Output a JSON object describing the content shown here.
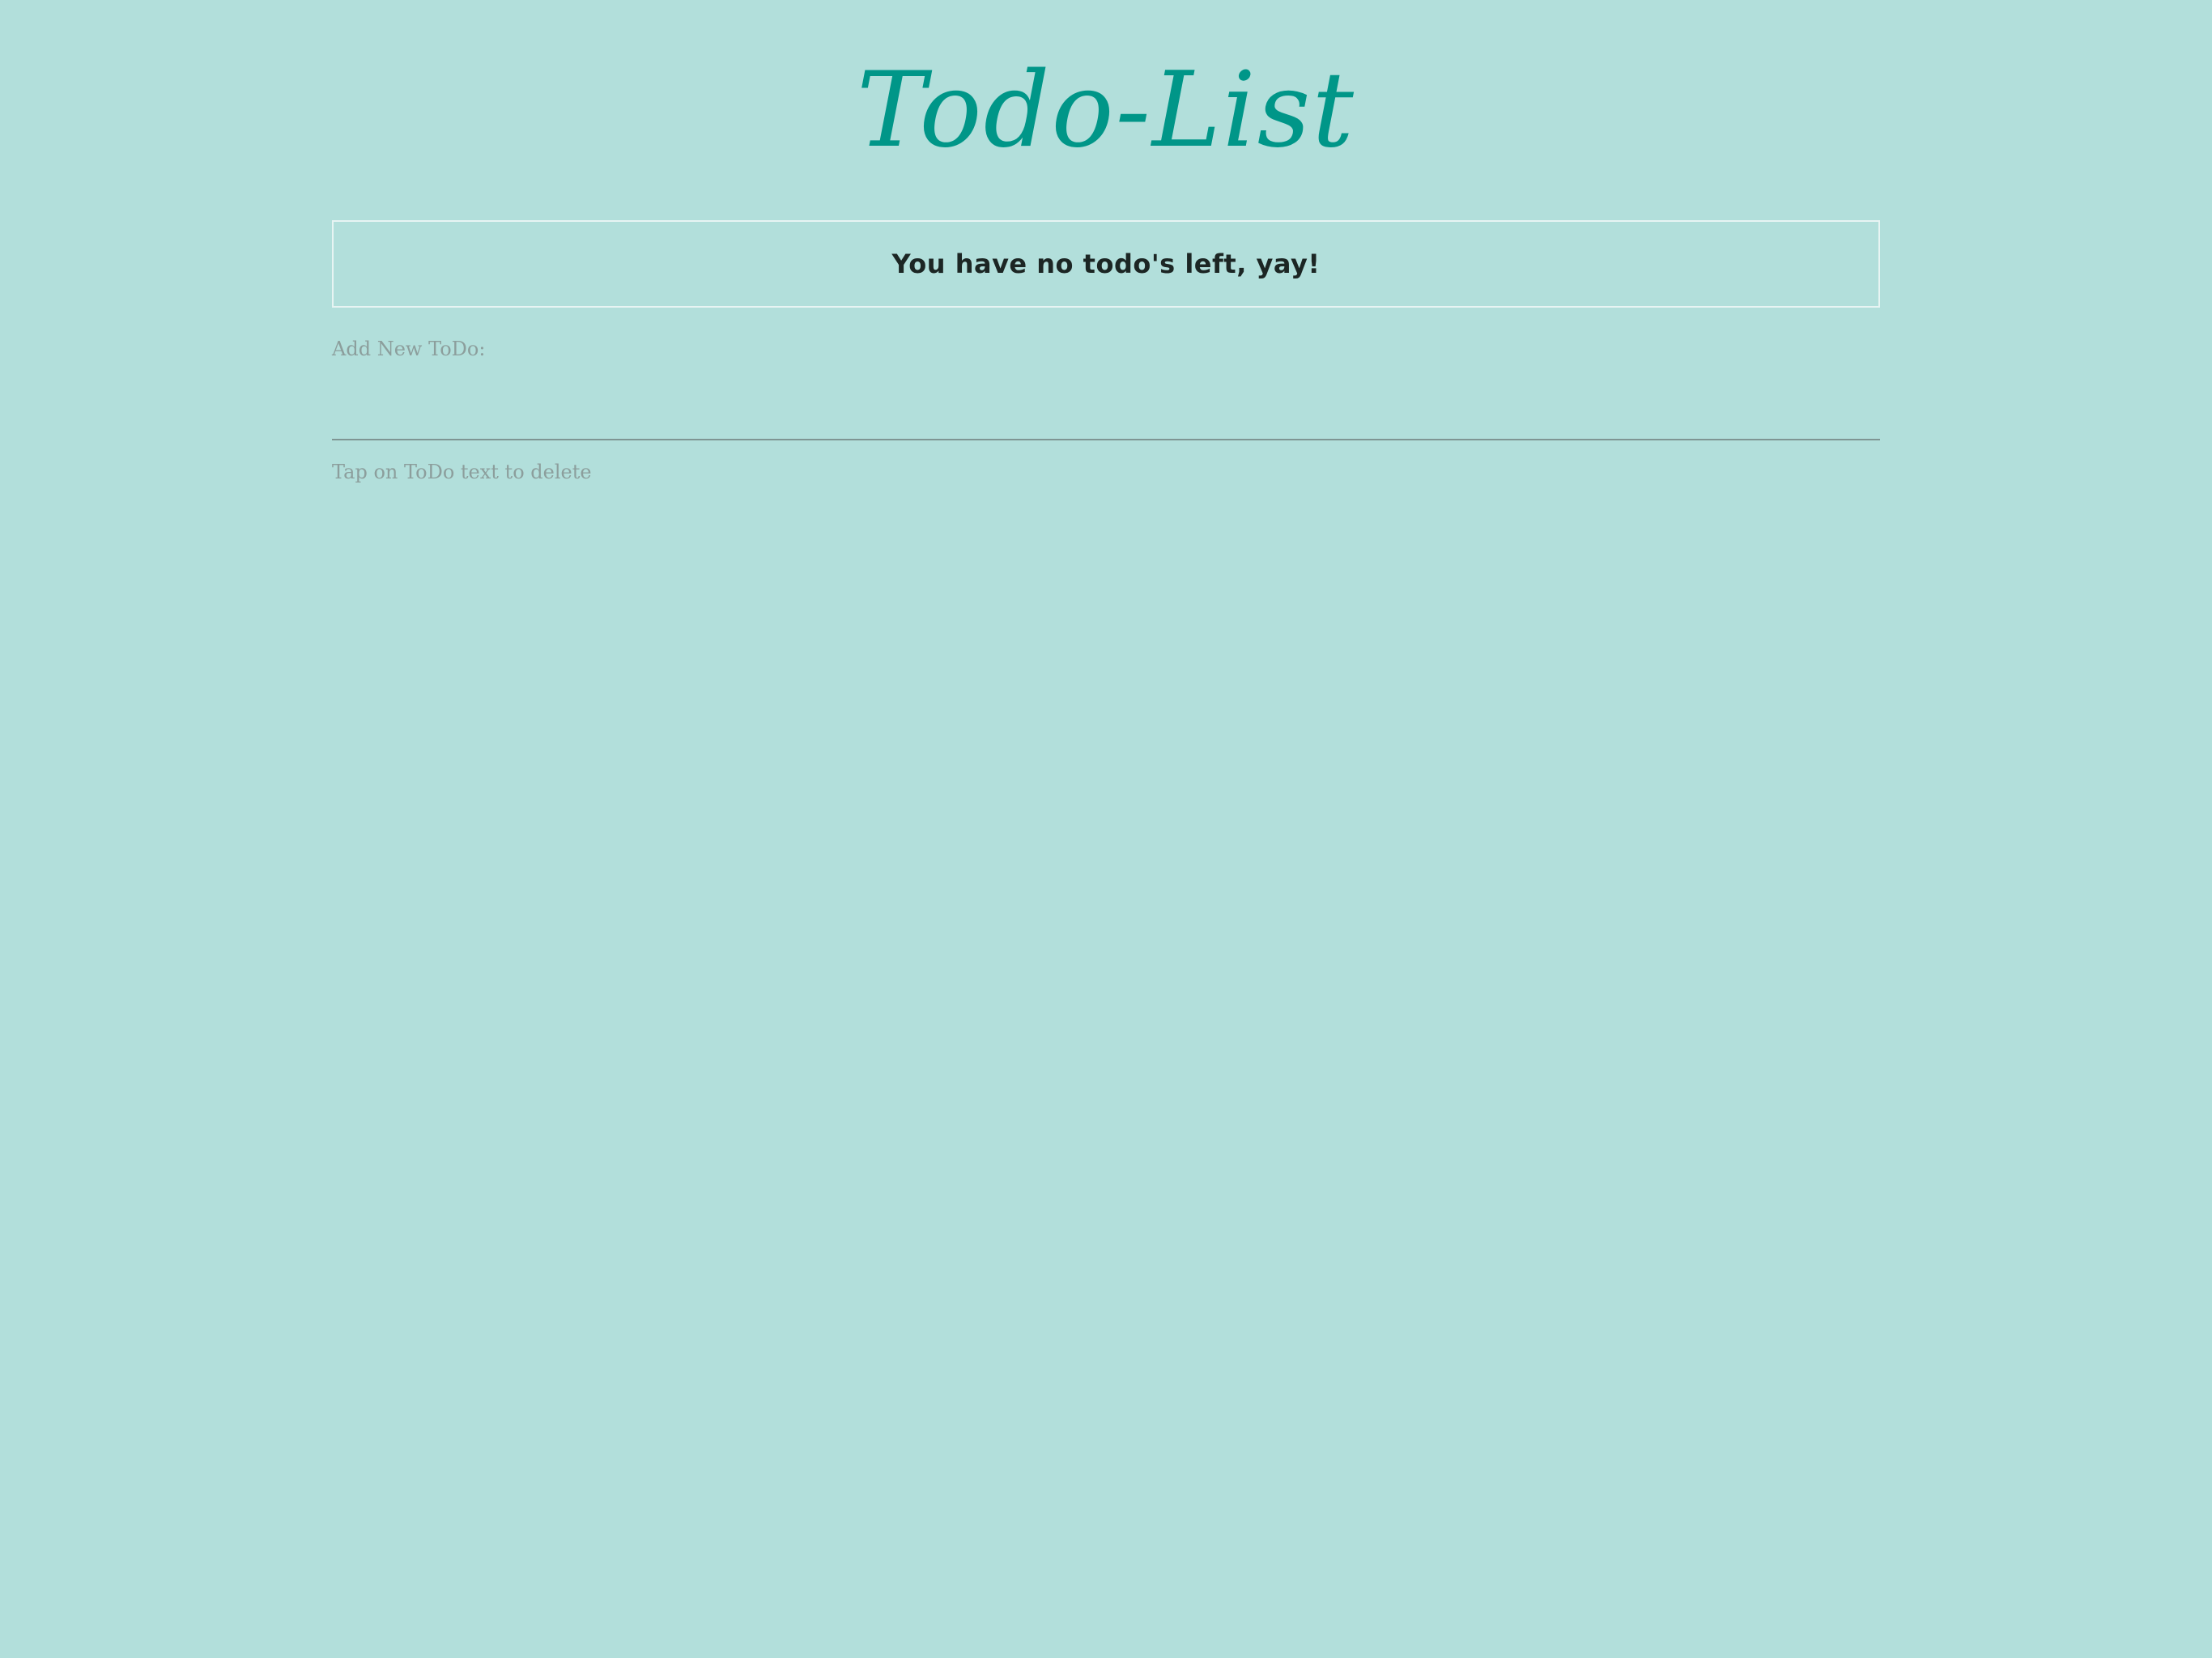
{
  "header": {
    "title": "Todo-List"
  },
  "todos": {
    "empty_message": "You have no todo's left, yay!",
    "items": []
  },
  "add_form": {
    "label": "Add New ToDo:",
    "value": "",
    "placeholder": ""
  },
  "footer": {
    "hint": "Tap on ToDo text to delete"
  },
  "colors": {
    "background": "#b2dfdb",
    "accent": "#009688",
    "muted_text": "#8c9e9c"
  }
}
